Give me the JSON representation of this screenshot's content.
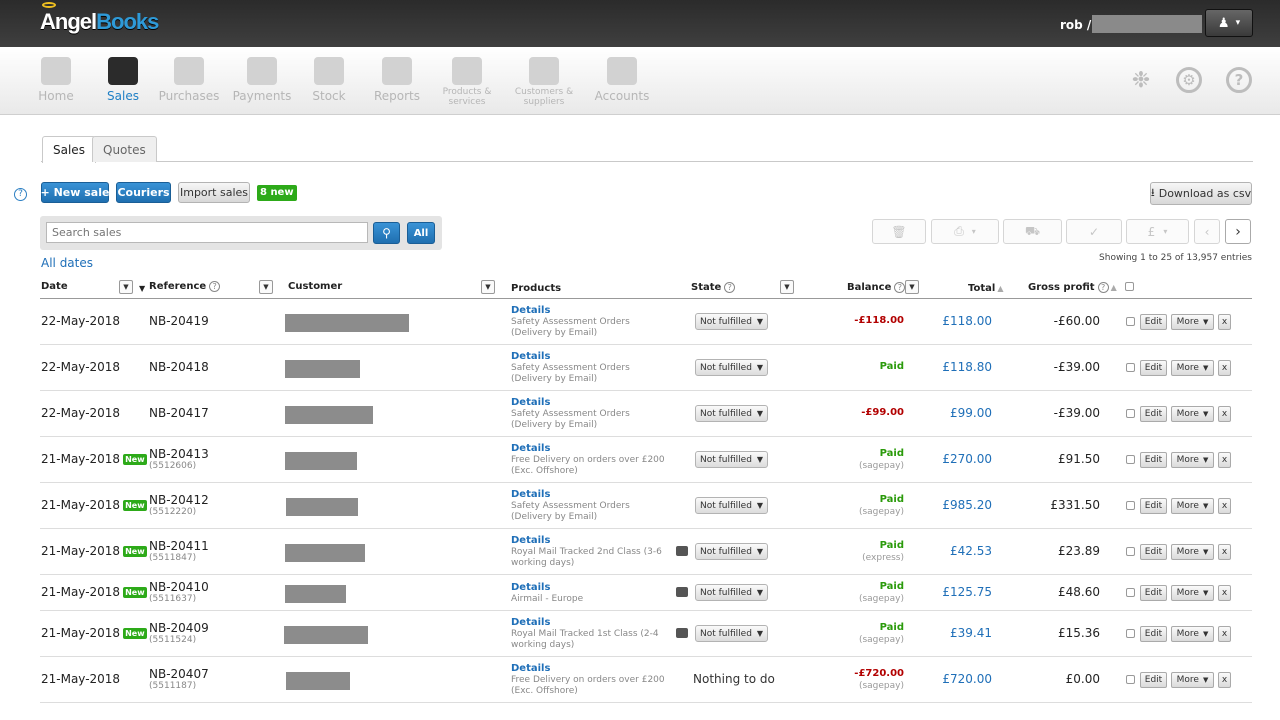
{
  "header": {
    "logo_angel": "Angel",
    "logo_books": "Books",
    "username": "rob /",
    "user_menu_caret": "▾"
  },
  "nav": [
    {
      "label": "Home",
      "icon": "home-icon"
    },
    {
      "label": "Sales",
      "icon": "sales-icon",
      "active": true
    },
    {
      "label": "Purchases",
      "icon": "purchases-icon"
    },
    {
      "label": "Payments",
      "icon": "piggy-bank-icon"
    },
    {
      "label": "Stock",
      "icon": "cart-icon"
    },
    {
      "label": "Reports",
      "icon": "chart-icon"
    },
    {
      "label": "Products & services",
      "icon": "products-icon"
    },
    {
      "label": "Customers & suppliers",
      "icon": "customers-icon"
    },
    {
      "label": "Accounts",
      "icon": "scales-icon"
    }
  ],
  "tabs": {
    "sales": "Sales",
    "quotes": "Quotes"
  },
  "toolbar": {
    "new_sale": "+ New sale",
    "couriers": "Couriers",
    "import_sales": "Import sales",
    "new_badge": "8 new",
    "download_csv": "Download as csv"
  },
  "search": {
    "placeholder": "Search sales",
    "all": "All"
  },
  "filters": {
    "all_dates": "All dates"
  },
  "showing": "Showing 1 to 25 of 13,957 entries",
  "columns": {
    "date": "Date",
    "reference": "Reference",
    "customer": "Customer",
    "products": "Products",
    "state": "State",
    "balance": "Balance",
    "total": "Total",
    "gross_profit": "Gross profit"
  },
  "row_buttons": {
    "edit": "Edit",
    "more": "More",
    "x": "x",
    "new": "New",
    "details": "Details"
  },
  "rows": [
    {
      "date": "22-May-2018",
      "ref": "NB-20419",
      "sub": "",
      "new": false,
      "desc": "Safety Assessment Orders (Delivery by Email)",
      "print": false,
      "state": "Not fulfilled",
      "balance": "-£118.00",
      "bal_note": "",
      "bal_type": "neg",
      "total": "£118.00",
      "gp": "-£60.00"
    },
    {
      "date": "22-May-2018",
      "ref": "NB-20418",
      "sub": "",
      "new": false,
      "desc": "Safety Assessment Orders (Delivery by Email)",
      "print": false,
      "state": "Not fulfilled",
      "balance": "Paid",
      "bal_note": "",
      "bal_type": "paid",
      "total": "£118.80",
      "gp": "-£39.00"
    },
    {
      "date": "22-May-2018",
      "ref": "NB-20417",
      "sub": "",
      "new": false,
      "desc": "Safety Assessment Orders (Delivery by Email)",
      "print": false,
      "state": "Not fulfilled",
      "balance": "-£99.00",
      "bal_note": "",
      "bal_type": "neg",
      "total": "£99.00",
      "gp": "-£39.00"
    },
    {
      "date": "21-May-2018",
      "ref": "NB-20413",
      "sub": "(5512606)",
      "new": true,
      "desc": "Free Delivery on orders over £200 (Exc. Offshore)",
      "print": false,
      "state": "Not fulfilled",
      "balance": "Paid",
      "bal_note": "(sagepay)",
      "bal_type": "paid",
      "total": "£270.00",
      "gp": "£91.50"
    },
    {
      "date": "21-May-2018",
      "ref": "NB-20412",
      "sub": "(5512220)",
      "new": true,
      "desc": "Safety Assessment Orders (Delivery by Email)",
      "print": false,
      "state": "Not fulfilled",
      "balance": "Paid",
      "bal_note": "(sagepay)",
      "bal_type": "paid",
      "total": "£985.20",
      "gp": "£331.50"
    },
    {
      "date": "21-May-2018",
      "ref": "NB-20411",
      "sub": "(5511847)",
      "new": true,
      "desc": "Royal Mail Tracked 2nd Class (3-6 working days)",
      "print": true,
      "state": "Not fulfilled",
      "balance": "Paid",
      "bal_note": "(express)",
      "bal_type": "paid",
      "total": "£42.53",
      "gp": "£23.89"
    },
    {
      "date": "21-May-2018",
      "ref": "NB-20410",
      "sub": "(5511637)",
      "new": true,
      "desc": "Airmail - Europe",
      "print": true,
      "state": "Not fulfilled",
      "balance": "Paid",
      "bal_note": "(sagepay)",
      "bal_type": "paid",
      "total": "£125.75",
      "gp": "£48.60"
    },
    {
      "date": "21-May-2018",
      "ref": "NB-20409",
      "sub": "(5511524)",
      "new": true,
      "desc": "Royal Mail Tracked 1st Class (2-4 working days)",
      "print": true,
      "state": "Not fulfilled",
      "balance": "Paid",
      "bal_note": "(sagepay)",
      "bal_type": "paid",
      "total": "£39.41",
      "gp": "£15.36"
    },
    {
      "date": "21-May-2018",
      "ref": "NB-20407",
      "sub": "(5511187)",
      "new": false,
      "desc": "Free Delivery on orders over £200 (Exc. Offshore)",
      "print": false,
      "state": "Nothing to do",
      "state_plain": true,
      "balance": "-£720.00",
      "bal_note": "(sagepay)",
      "bal_type": "neg",
      "total": "£720.00",
      "gp": "£0.00"
    }
  ]
}
